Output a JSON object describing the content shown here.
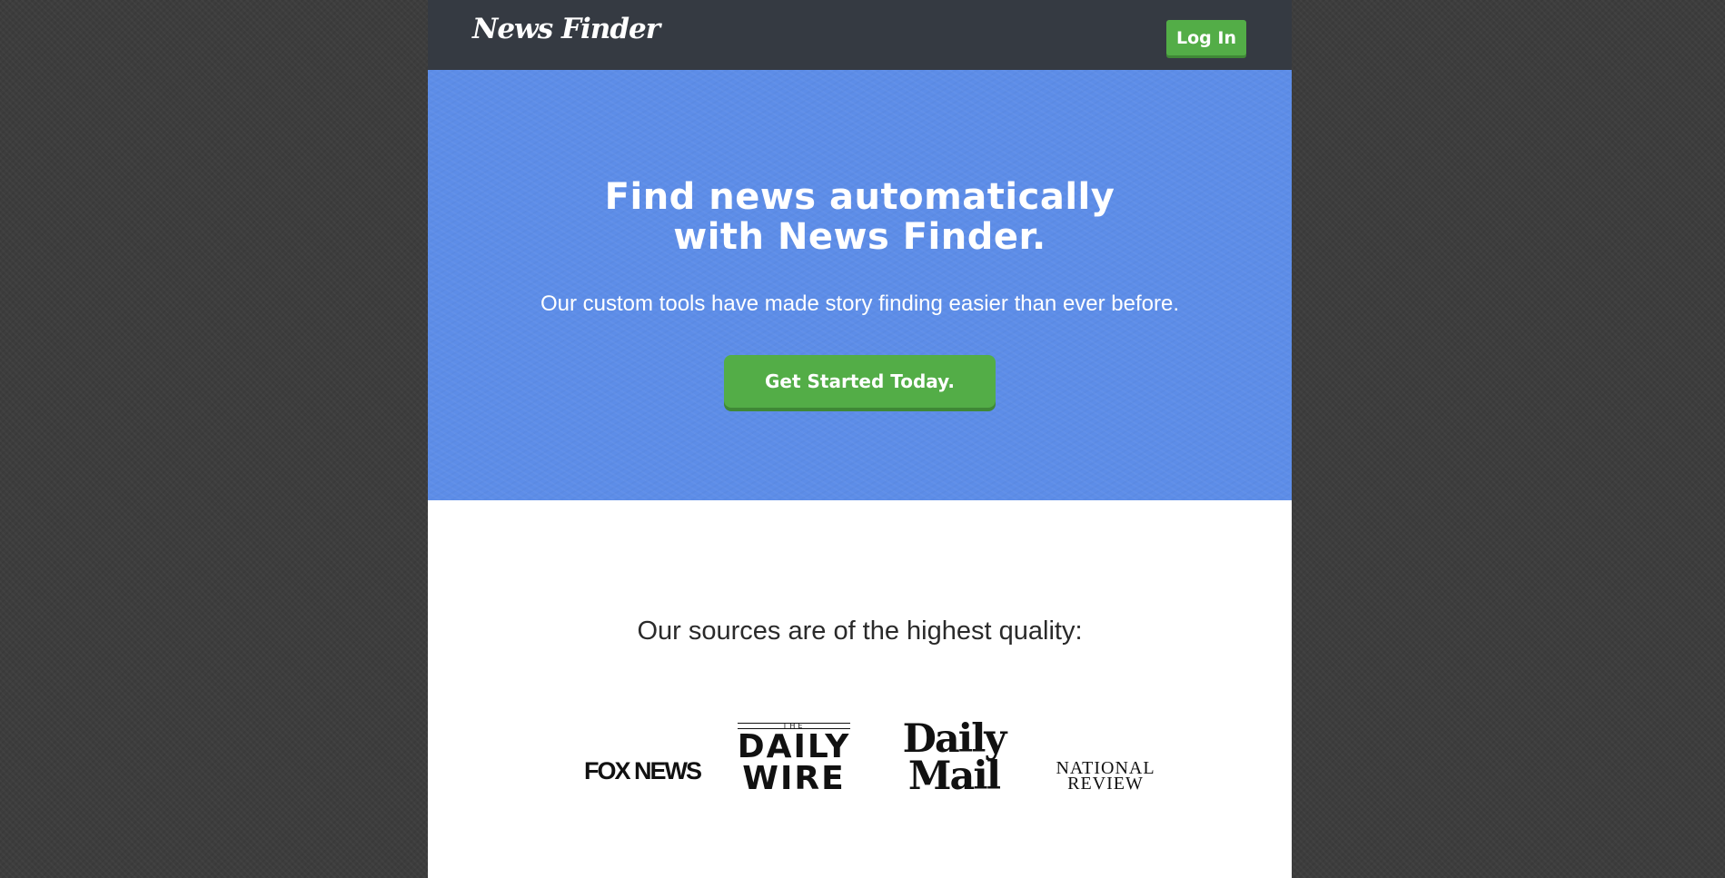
{
  "header": {
    "logo": "News Finder",
    "login_label": "Log In"
  },
  "hero": {
    "title_line1": "Find news automatically",
    "title_line2": "with News Finder.",
    "subtitle": "Our custom tools have made story finding easier than ever before.",
    "cta_label": "Get Started Today."
  },
  "sources": {
    "heading": "Our sources are of the highest quality:",
    "logos": {
      "fox_news": "FOX NEWS",
      "daily_wire_the": "THE",
      "daily_wire_line1": "DAILY",
      "daily_wire_line2": "WIRE",
      "daily_mail_line1": "Daily",
      "daily_mail_line2": "Mail",
      "national_review_line1": "NATIONAL",
      "national_review_line2": "REVIEW"
    }
  },
  "colors": {
    "header_bg": "#353a42",
    "hero_bg": "#5d8de8",
    "button_green": "#53ad47",
    "page_bg": "#3d3d3d"
  }
}
